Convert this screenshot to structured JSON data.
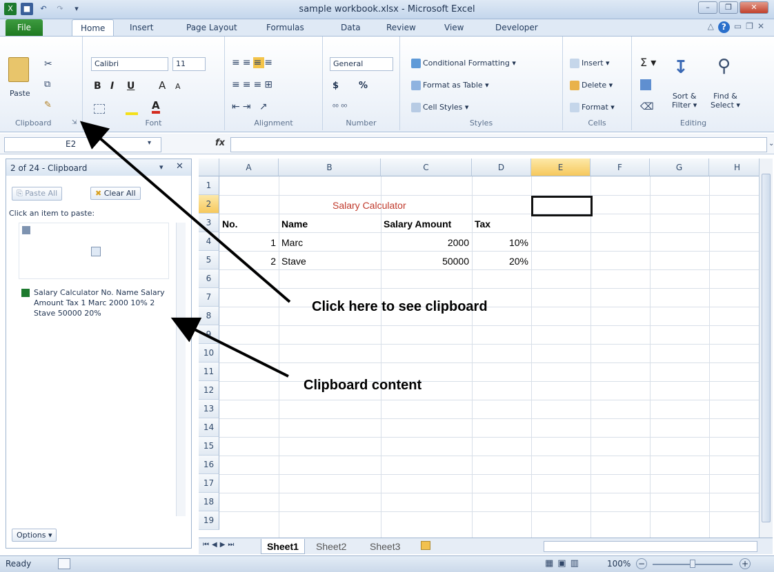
{
  "window": {
    "title": "sample workbook.xlsx - Microsoft Excel"
  },
  "ribbon_tabs": [
    {
      "label": "File"
    },
    {
      "label": "Home"
    },
    {
      "label": "Insert"
    },
    {
      "label": "Page Layout"
    },
    {
      "label": "Formulas"
    },
    {
      "label": "Data"
    },
    {
      "label": "Review"
    },
    {
      "label": "View"
    },
    {
      "label": "Developer"
    }
  ],
  "ribbon": {
    "clipboard": {
      "label": "Clipboard",
      "paste": "Paste"
    },
    "font": {
      "label": "Font",
      "name": "Calibri",
      "size": "11"
    },
    "alignment": {
      "label": "Alignment"
    },
    "number": {
      "label": "Number",
      "format": "General",
      "currency": "$",
      "percent": "%"
    },
    "styles": {
      "label": "Styles",
      "conditional": "Conditional Formatting",
      "table": "Format as Table",
      "cell": "Cell Styles"
    },
    "cells": {
      "label": "Cells",
      "insert": "Insert",
      "delete": "Delete",
      "format": "Format"
    },
    "editing": {
      "label": "Editing",
      "sort": "Sort &",
      "filter": "Filter",
      "find": "Find &",
      "select": "Select"
    }
  },
  "formula_bar": {
    "name_box": "E2",
    "fx": "fx",
    "value": ""
  },
  "clipboard_pane": {
    "title": "2 of 24 - Clipboard",
    "paste_all": "Paste All",
    "clear_all": "Clear All",
    "hint": "Click an item to paste:",
    "item_text": "Salary Calculator No. Name Salary Amount Tax 1 Marc 2000 10% 2 Stave 50000 20%",
    "options": "Options"
  },
  "sheet": {
    "columns": [
      "A",
      "B",
      "C",
      "D",
      "E",
      "F",
      "G",
      "H"
    ],
    "rows": [
      "1",
      "2",
      "3",
      "4",
      "5",
      "6",
      "7",
      "8",
      "9",
      "10",
      "11",
      "12",
      "13",
      "14",
      "15",
      "16",
      "17",
      "18",
      "19"
    ],
    "title": "Salary Calculator",
    "headers": {
      "no": "No.",
      "name": "Name",
      "salary": "Salary Amount",
      "tax": "Tax"
    },
    "data": [
      {
        "no": "1",
        "name": "Marc",
        "salary": "2000",
        "tax": "10%"
      },
      {
        "no": "2",
        "name": "Stave",
        "salary": "50000",
        "tax": "20%"
      }
    ],
    "selected_cell": "E2"
  },
  "sheet_tabs": [
    "Sheet1",
    "Sheet2",
    "Sheet3"
  ],
  "status": {
    "ready": "Ready",
    "zoom": "100%"
  },
  "annotations": {
    "clipboard_launcher": "Click here to see clipboard",
    "clipboard_content": "Clipboard content"
  }
}
